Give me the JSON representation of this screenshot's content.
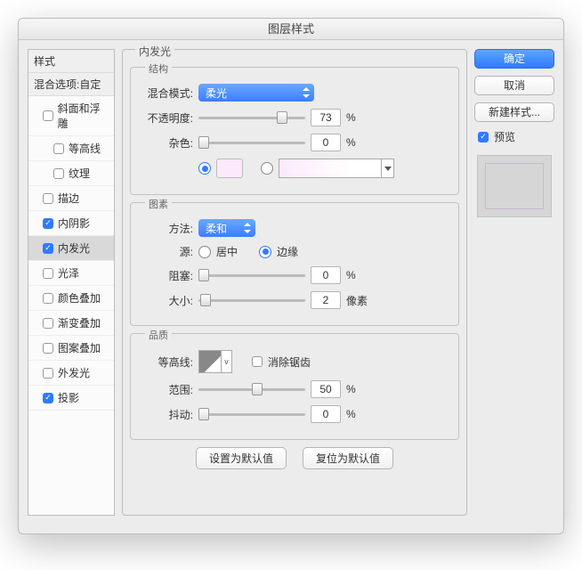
{
  "title": "图层样式",
  "sidebar": {
    "header_styles": "样式",
    "header_blend": "混合选项:自定",
    "items": [
      {
        "label": "斜面和浮雕",
        "checked": false,
        "indent": 1
      },
      {
        "label": "等高线",
        "checked": false,
        "indent": 2
      },
      {
        "label": "纹理",
        "checked": false,
        "indent": 2
      },
      {
        "label": "描边",
        "checked": false,
        "indent": 1
      },
      {
        "label": "内阴影",
        "checked": true,
        "indent": 1
      },
      {
        "label": "内发光",
        "checked": true,
        "indent": 1,
        "selected": true
      },
      {
        "label": "光泽",
        "checked": false,
        "indent": 1
      },
      {
        "label": "颜色叠加",
        "checked": false,
        "indent": 1
      },
      {
        "label": "渐变叠加",
        "checked": false,
        "indent": 1
      },
      {
        "label": "图案叠加",
        "checked": false,
        "indent": 1
      },
      {
        "label": "外发光",
        "checked": false,
        "indent": 1
      },
      {
        "label": "投影",
        "checked": true,
        "indent": 1
      }
    ]
  },
  "panel": {
    "title": "内发光",
    "structure": {
      "legend": "结构",
      "blend_label": "混合模式:",
      "blend_value": "柔光",
      "opacity_label": "不透明度:",
      "opacity_value": "73",
      "opacity_unit": "%",
      "noise_label": "杂色:",
      "noise_value": "0",
      "noise_unit": "%"
    },
    "elements": {
      "legend": "图素",
      "technique_label": "方法:",
      "technique_value": "柔和",
      "source_label": "源:",
      "source_center": "居中",
      "source_edge": "边缘",
      "choke_label": "阻塞:",
      "choke_value": "0",
      "choke_unit": "%",
      "size_label": "大小:",
      "size_value": "2",
      "size_unit": "像素"
    },
    "quality": {
      "legend": "品质",
      "contour_label": "等高线:",
      "antialias": "消除锯齿",
      "range_label": "范围:",
      "range_value": "50",
      "range_unit": "%",
      "jitter_label": "抖动:",
      "jitter_value": "0",
      "jitter_unit": "%"
    },
    "buttons": {
      "default": "设置为默认值",
      "reset": "复位为默认值"
    }
  },
  "right": {
    "ok": "确定",
    "cancel": "取消",
    "new_style": "新建样式...",
    "preview": "预览"
  }
}
